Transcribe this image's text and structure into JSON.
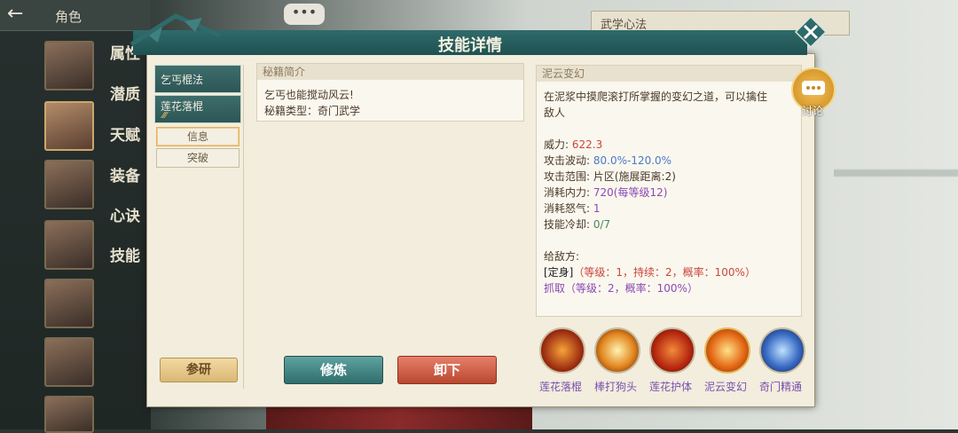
{
  "background": {
    "top_label": "角色",
    "tabs": [
      "属性",
      "潜质",
      "天赋",
      "装备",
      "心诀",
      "技能"
    ],
    "right_panel_title": "武学心法"
  },
  "modal": {
    "title": "技能详情",
    "skill_tabs": [
      "乞丐棍法",
      "莲花落棍"
    ],
    "sub_tabs": [
      "信息",
      "突破"
    ],
    "research_button": "参研",
    "intro": {
      "header": "秘籍简介",
      "line1": "乞丐也能搅动风云!",
      "line2": "秘籍类型：奇门武学"
    },
    "practice_button": "修炼",
    "unequip_button": "卸下",
    "detail": {
      "header": "泥云变幻",
      "desc1": "在泥浆中摸爬滚打所掌握的变幻之道，可以擒住",
      "desc2": "敌人",
      "stats": [
        {
          "key": "威力:",
          "value": "622.3",
          "tone": "red"
        },
        {
          "key": "攻击波动:",
          "value": "80.0%-120.0%",
          "tone": "blue"
        },
        {
          "key": "攻击范围:",
          "value": "片区(施展距离:2)",
          "tone": "plain"
        },
        {
          "key": "消耗内力:",
          "value": "720(每等级12)",
          "tone": "purple"
        },
        {
          "key": "消耗怒气:",
          "value": "1",
          "tone": "purple"
        },
        {
          "key": "技能冷却:",
          "value": "0/7",
          "tone": "green"
        }
      ],
      "enemy_label": "给敌方:",
      "effect1_name": "[定身]",
      "effect1_detail": "（等级：1，持续：2，概率：100%）",
      "effect2": "抓取（等级：2，概率：100%）"
    },
    "skills": [
      "莲花落棍",
      "棒打狗头",
      "莲花护体",
      "泥云变幻",
      "奇门精通"
    ],
    "discuss_label": "讨论"
  }
}
